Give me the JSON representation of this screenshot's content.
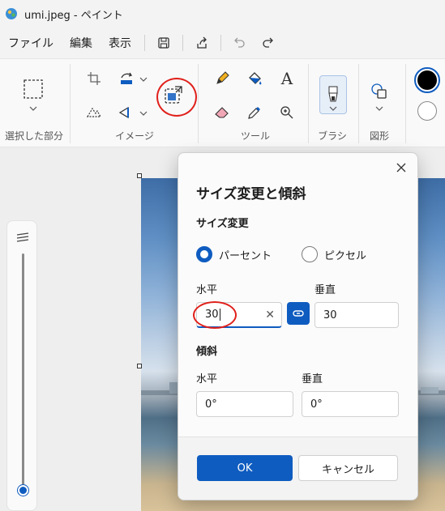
{
  "window": {
    "title": "umi.jpeg - ペイント"
  },
  "menu": {
    "file": "ファイル",
    "edit": "編集",
    "view": "表示"
  },
  "ribbon": {
    "groups": {
      "selection": "選択した部分",
      "image": "イメージ",
      "tools": "ツール",
      "brush": "ブラシ",
      "shapes": "図形"
    },
    "text_tool_glyph": "A"
  },
  "colors": {
    "primary": "#000000",
    "secondary": "#ffffff",
    "accent": "#0f5cc0",
    "annotation": "#e0201b"
  },
  "dialog": {
    "title": "サイズ変更と傾斜",
    "resize_section": "サイズ変更",
    "unit_percent": "パーセント",
    "unit_pixel": "ピクセル",
    "resize_horizontal_label": "水平",
    "resize_vertical_label": "垂直",
    "resize_horizontal_value": "30",
    "resize_vertical_value": "30",
    "skew_section": "傾斜",
    "skew_horizontal_label": "水平",
    "skew_vertical_label": "垂直",
    "skew_horizontal_value": "0°",
    "skew_vertical_value": "0°",
    "ok": "OK",
    "cancel": "キャンセル"
  }
}
